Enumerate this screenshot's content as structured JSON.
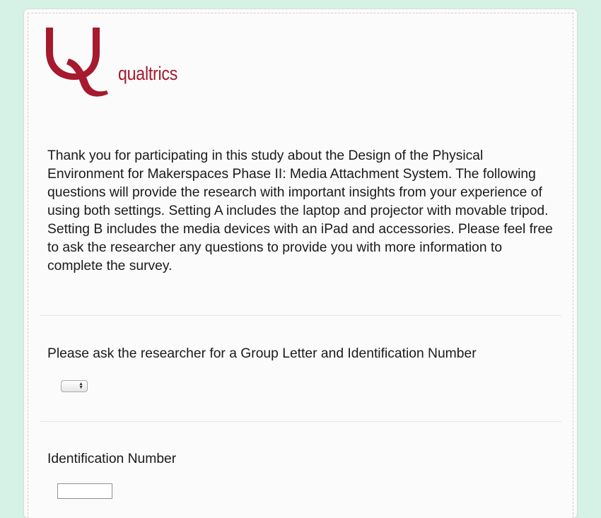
{
  "brand": {
    "name": "qualtrics",
    "color": "#a6192e"
  },
  "intro": {
    "text": "Thank you for participating in this study about the Design of the Physical Environment for Makerspaces Phase II: Media Attachment System. The following questions will provide the research with important insights from your experience of using both settings. Setting A includes the laptop and projector with movable tripod. Setting B includes the media devices with an iPad and accessories. Please feel free to ask the researcher any questions to provide you with more information to complete the survey."
  },
  "questions": [
    {
      "text": "Please ask the researcher for a Group Letter and Identification Number",
      "control": "select",
      "selected": ""
    },
    {
      "text": "Identification Number",
      "control": "text-input",
      "value": ""
    }
  ],
  "colors": {
    "background": "#d6f1e6",
    "panel": "#fbfbfb"
  }
}
